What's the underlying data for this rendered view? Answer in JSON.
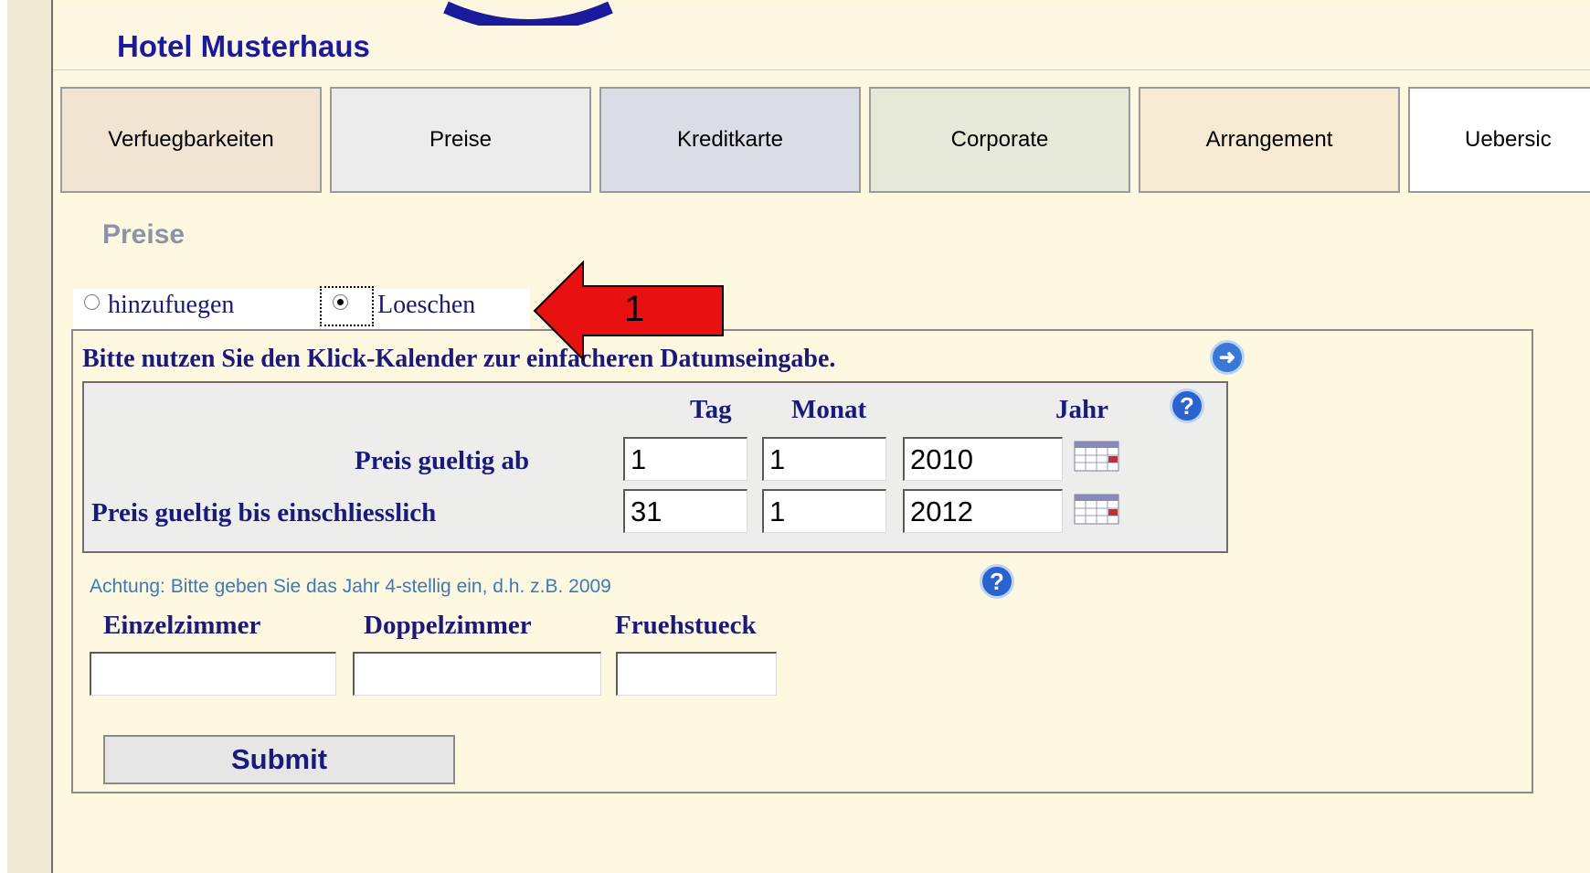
{
  "header": {
    "hotel_name": "Hotel Musterhaus"
  },
  "tabs": [
    {
      "label": "Verfuegbarkeiten",
      "color": "#f2e4d2"
    },
    {
      "label": "Preise",
      "color": "#ececec"
    },
    {
      "label": "Kreditkarte",
      "color": "#d9dde6"
    },
    {
      "label": "Corporate",
      "color": "#e6e9d8"
    },
    {
      "label": "Arrangement",
      "color": "#f7ead2"
    },
    {
      "label": "Uebersic",
      "color": "#ffffff"
    }
  ],
  "section_title": "Preise",
  "mode": {
    "options": [
      "hinzufuegen",
      "Loeschen"
    ],
    "selected": "Loeschen"
  },
  "instruction": "Bitte nutzen Sie den Klick-Kalender zur einfacheren Datumseingabe.",
  "date_table": {
    "headers": {
      "day": "Tag",
      "month": "Monat",
      "year": "Jahr"
    },
    "rows": [
      {
        "label": "Preis gueltig ab",
        "day": "1",
        "month": "1",
        "year": "2010"
      },
      {
        "label": "Preis gueltig bis einschliesslich",
        "day": "31",
        "month": "1",
        "year": "2012"
      }
    ]
  },
  "warning": "Achtung: Bitte geben Sie das Jahr 4-stellig ein, d.h. z.B. 2009",
  "price_fields": {
    "labels": [
      "Einzelzimmer",
      "Doppelzimmer",
      "Fruehstueck"
    ],
    "values": [
      "",
      "",
      ""
    ]
  },
  "submit_label": "Submit",
  "annotation": {
    "label": "1",
    "color": "#e81010"
  },
  "icons": {
    "arrow": "arrow-right-icon",
    "help": "help-icon",
    "calendar": "calendar-icon"
  }
}
